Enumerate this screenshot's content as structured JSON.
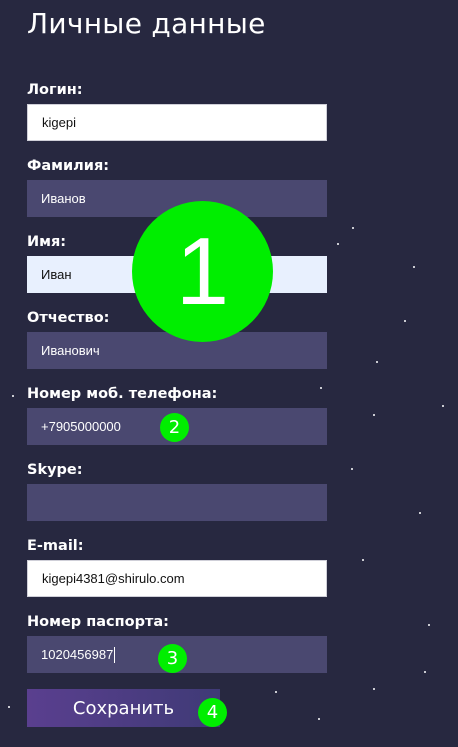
{
  "page": {
    "title": "Личные данные"
  },
  "form": {
    "login": {
      "label": "Логин:",
      "value": "kigepi"
    },
    "surname": {
      "label": "Фамилия:",
      "value": "Иванов"
    },
    "name": {
      "label": "Имя:",
      "value": "Иван"
    },
    "patronymic": {
      "label": "Отчество:",
      "value": "Иванович"
    },
    "phone": {
      "label": "Номер моб. телефона:",
      "value": "+7905000000"
    },
    "skype": {
      "label": "Skype:",
      "value": ""
    },
    "email": {
      "label": "E-mail:",
      "value": "kigepi4381@shirulo.com"
    },
    "passport": {
      "label": "Номер паспорта:",
      "value": "1020456987"
    },
    "save_label": "Сохранить"
  },
  "annotations": {
    "marker_1": "1",
    "marker_2": "2",
    "marker_3": "3",
    "marker_4": "4",
    "color": "#00ee00"
  },
  "colors": {
    "background": "#272840",
    "input_dark": "#4a4870",
    "button_gradient_start": "#5a3f8f",
    "button_gradient_end": "#3f3a76"
  }
}
